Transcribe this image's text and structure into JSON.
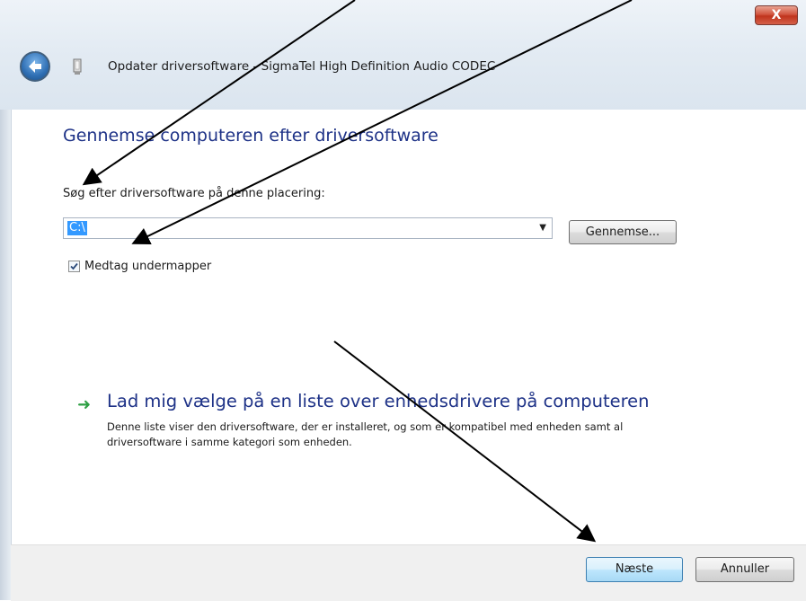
{
  "window": {
    "title": "Opdater driversoftware - SigmaTel High Definition Audio CODEC",
    "close_glyph": "X"
  },
  "page": {
    "title": "Gennemse computeren efter driversoftware",
    "search_label": "Søg efter driversoftware på denne placering:",
    "path_value": "C:\\",
    "browse_label": "Gennemse...",
    "include_subfolders": {
      "label": "Medtag undermapper",
      "checked": true
    }
  },
  "link": {
    "title": "Lad mig vælge på en liste over enhedsdrivere på computeren",
    "description": "Denne liste viser den driversoftware, der er installeret, og som er kompatibel med enheden samt al driversoftware i samme kategori som enheden."
  },
  "footer": {
    "next_label": "Næste",
    "cancel_label": "Annuller"
  },
  "colors": {
    "heading": "#1e3287",
    "selection": "#3399ff",
    "link_arrow": "#2ea044",
    "close_button": "#c0331c"
  },
  "icons": [
    "back-arrow-icon",
    "device-icon",
    "close-icon",
    "dropdown-arrow-icon",
    "green-arrow-icon",
    "checkmark-icon"
  ]
}
